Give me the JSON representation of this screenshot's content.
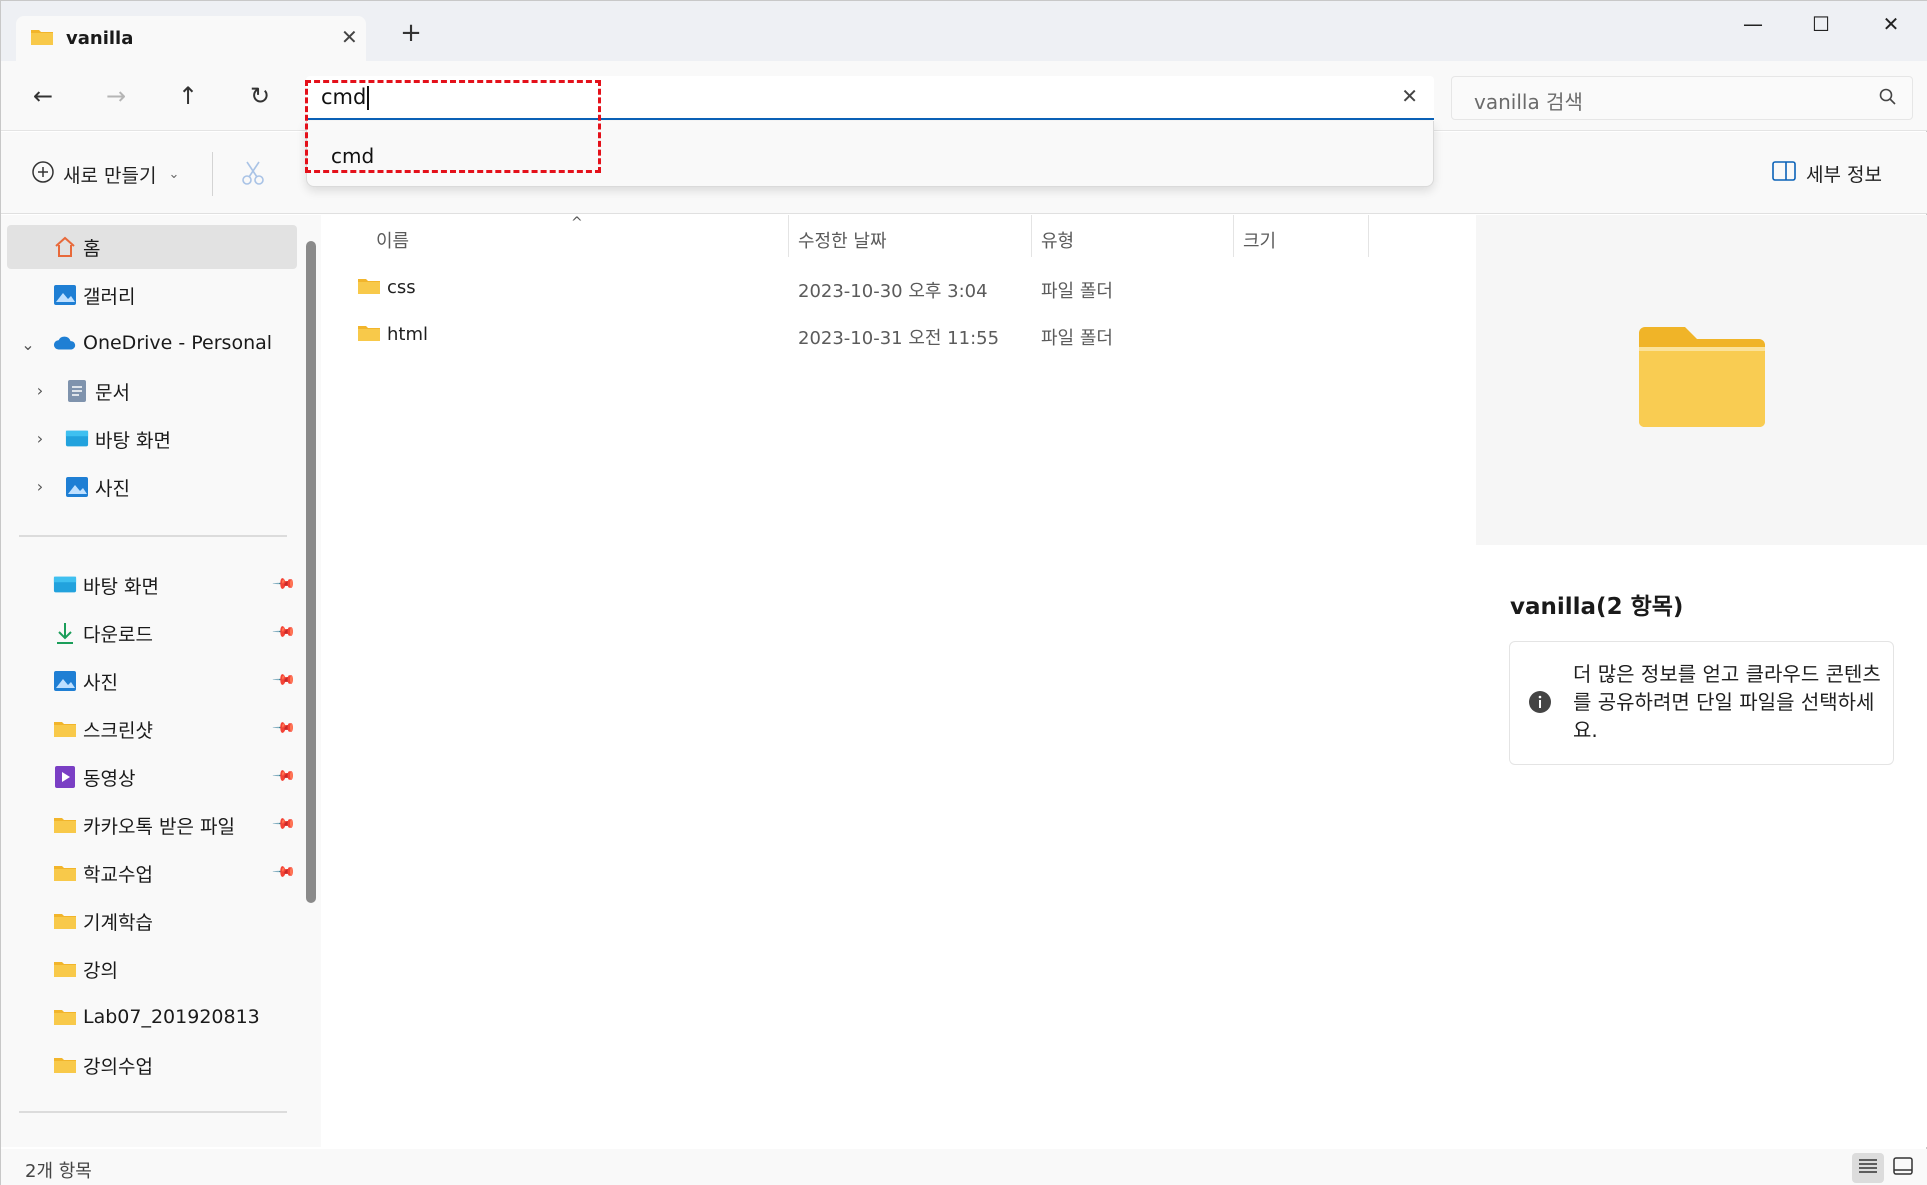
{
  "tab": {
    "title": "vanilla",
    "close": "✕",
    "new_tab": "+"
  },
  "window_controls": {
    "minimize": "—",
    "maximize": "☐",
    "close": "✕"
  },
  "nav": {
    "back": "←",
    "forward": "→",
    "up": "↑",
    "refresh": "↻"
  },
  "address": {
    "value": "cmd",
    "clear": "✕"
  },
  "suggestion": {
    "item": "cmd"
  },
  "search": {
    "placeholder": "vanilla 검색"
  },
  "toolbar": {
    "new_label": "새로 만들기",
    "details_label": "세부 정보"
  },
  "sidebar": {
    "home": "홈",
    "gallery": "갤러리",
    "onedrive": "OneDrive - Personal",
    "onedrive_children": [
      "문서",
      "바탕 화면",
      "사진"
    ],
    "quick_access": [
      {
        "label": "바탕 화면",
        "pinned": true,
        "icon": "desktop-icon"
      },
      {
        "label": "다운로드",
        "pinned": true,
        "icon": "download-icon"
      },
      {
        "label": "사진",
        "pinned": true,
        "icon": "pictures-icon"
      },
      {
        "label": "스크린샷",
        "pinned": true,
        "icon": "folder-icon"
      },
      {
        "label": "동영상",
        "pinned": true,
        "icon": "video-icon"
      },
      {
        "label": "카카오톡 받은 파일",
        "pinned": true,
        "icon": "folder-icon"
      },
      {
        "label": "학교수업",
        "pinned": true,
        "icon": "folder-icon"
      },
      {
        "label": "기계학습",
        "pinned": false,
        "icon": "folder-icon"
      },
      {
        "label": "강의",
        "pinned": false,
        "icon": "folder-icon"
      },
      {
        "label": "Lab07_201920813",
        "pinned": false,
        "icon": "folder-icon"
      },
      {
        "label": "강의수업",
        "pinned": false,
        "icon": "folder-icon"
      }
    ]
  },
  "columns": {
    "name": "이름",
    "modified": "수정한 날짜",
    "type": "유형",
    "size": "크기"
  },
  "files": [
    {
      "name": "css",
      "modified": "2023-10-30 오후 3:04",
      "type": "파일 폴더",
      "size": ""
    },
    {
      "name": "html",
      "modified": "2023-10-31 오전 11:55",
      "type": "파일 폴더",
      "size": ""
    }
  ],
  "details": {
    "title": "vanilla(2 항목)",
    "info": "더 많은 정보를 얻고 클라우드 콘텐츠를 공유하려면 단일 파일을 선택하세요."
  },
  "status": {
    "count": "2개 항목"
  },
  "colors": {
    "accent": "#0b62b8",
    "highlight": "#e4101a",
    "folder": "#f8c94a"
  }
}
